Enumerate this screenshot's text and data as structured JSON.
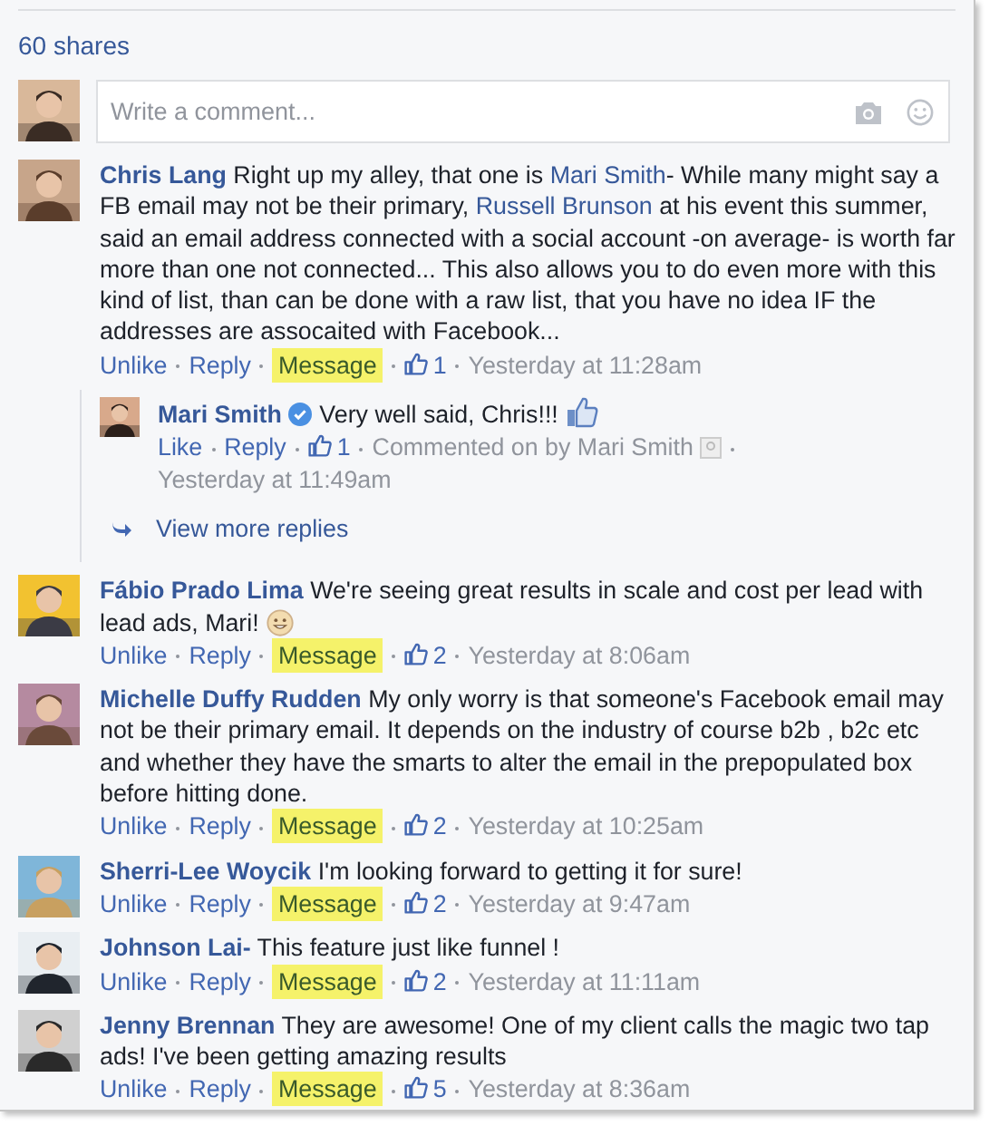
{
  "shares": "60 shares",
  "composer": {
    "placeholder": "Write a comment..."
  },
  "comments": [
    {
      "author": "Chris Lang",
      "segments": [
        {
          "kind": "text",
          "text": " Right up my alley, that one is "
        },
        {
          "kind": "link",
          "text": "Mari Smith"
        },
        {
          "kind": "text",
          "text": "- While many might say a FB email may not be their primary, "
        },
        {
          "kind": "link",
          "text": "Russell Brunson"
        },
        {
          "kind": "text",
          "text": " at his event this summer, said an email address connected with a social account -on average- is worth far more than one not connected... This also allows you to do even more with this kind of list, than can be done with a raw list, that you have no idea IF the addresses are assocaited with Facebook..."
        }
      ],
      "actions": [
        {
          "label": "Unlike",
          "highlighted": false
        },
        {
          "label": "Reply",
          "highlighted": false
        },
        {
          "label": "Message",
          "highlighted": true
        }
      ],
      "likes": "1",
      "time": "Yesterday at 11:28am",
      "replies": [
        {
          "author": "Mari Smith",
          "verified": true,
          "segments": [
            {
              "kind": "text",
              "text": " Very well said, Chris!!!"
            }
          ],
          "sticker": {
            "kind": "like"
          },
          "actions": [
            {
              "label": "Like",
              "highlighted": false
            },
            {
              "label": "Reply",
              "highlighted": false
            }
          ],
          "likes": "1",
          "note": "Commented on by Mari Smith",
          "time": "Yesterday at 11:49am"
        }
      ],
      "more_replies": "View more replies"
    },
    {
      "author": "Fábio Prado Lima",
      "segments": [
        {
          "kind": "text",
          "text": " We're seeing great results in scale and cost per lead with lead ads, Mari!"
        }
      ],
      "sticker": {
        "kind": "smile"
      },
      "actions": [
        {
          "label": "Unlike",
          "highlighted": false
        },
        {
          "label": "Reply",
          "highlighted": false
        },
        {
          "label": "Message",
          "highlighted": true
        }
      ],
      "likes": "2",
      "time": "Yesterday at 8:06am"
    },
    {
      "author": "Michelle Duffy Rudden",
      "segments": [
        {
          "kind": "text",
          "text": " My only worry is that someone's Facebook email may not be their primary email. It depends on the industry of course b2b , b2c etc and whether they have the smarts to alter the email in the prepopulated box before hitting done."
        }
      ],
      "actions": [
        {
          "label": "Unlike",
          "highlighted": false
        },
        {
          "label": "Reply",
          "highlighted": false
        },
        {
          "label": "Message",
          "highlighted": true
        }
      ],
      "likes": "2",
      "time": "Yesterday at 10:25am"
    },
    {
      "author": "Sherri-Lee Woycik",
      "segments": [
        {
          "kind": "text",
          "text": " I'm looking forward to getting it for sure!"
        }
      ],
      "actions": [
        {
          "label": "Unlike",
          "highlighted": false
        },
        {
          "label": "Reply",
          "highlighted": false
        },
        {
          "label": "Message",
          "highlighted": true
        }
      ],
      "likes": "2",
      "time": "Yesterday at 9:47am"
    },
    {
      "author": "Johnson Lai-",
      "segments": [
        {
          "kind": "text",
          "text": " This feature just like funnel !"
        }
      ],
      "actions": [
        {
          "label": "Unlike",
          "highlighted": false
        },
        {
          "label": "Reply",
          "highlighted": false
        },
        {
          "label": "Message",
          "highlighted": true
        }
      ],
      "likes": "2",
      "time": "Yesterday at 11:11am"
    },
    {
      "author": "Jenny Brennan",
      "segments": [
        {
          "kind": "text",
          "text": " They are awesome! One of my client calls the magic two tap ads! I've been getting amazing results"
        }
      ],
      "actions": [
        {
          "label": "Unlike",
          "highlighted": false
        },
        {
          "label": "Reply",
          "highlighted": false
        },
        {
          "label": "Message",
          "highlighted": true
        }
      ],
      "likes": "5",
      "time": "Yesterday at 8:36am"
    }
  ]
}
